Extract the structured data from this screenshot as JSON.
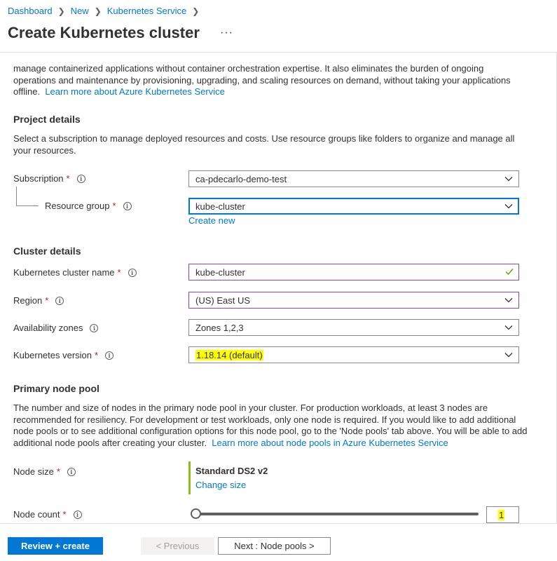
{
  "breadcrumb": [
    "Dashboard",
    "New",
    "Kubernetes Service"
  ],
  "page_title": "Create Kubernetes cluster",
  "more_label": "···",
  "intro": {
    "text": "manage containerized applications without container orchestration expertise. It also eliminates the burden of ongoing operations and maintenance by provisioning, upgrading, and scaling resources on demand, without taking your applications offline.",
    "link": "Learn more about Azure Kubernetes Service"
  },
  "project": {
    "heading": "Project details",
    "description": "Select a subscription to manage deployed resources and costs. Use resource groups like folders to organize and manage all your resources.",
    "subscription_label": "Subscription",
    "subscription_value": "ca-pdecarlo-demo-test",
    "resource_group_label": "Resource group",
    "resource_group_value": "kube-cluster",
    "create_new": "Create new"
  },
  "cluster": {
    "heading": "Cluster details",
    "name_label": "Kubernetes cluster name",
    "name_value": "kube-cluster",
    "region_label": "Region",
    "region_value": "(US) East US",
    "zones_label": "Availability zones",
    "zones_value": "Zones 1,2,3",
    "version_label": "Kubernetes version",
    "version_value": "1.18.14 (default)"
  },
  "node_pool": {
    "heading": "Primary node pool",
    "description": "The number and size of nodes in the primary node pool in your cluster. For production workloads, at least 3 nodes are recommended for resiliency. For development or test workloads, only one node is required. If you would like to add additional node pools or to see additional configuration options for this node pool, go to the 'Node pools' tab above. You will be able to add additional node pools after creating your cluster.",
    "link": "Learn more about node pools in Azure Kubernetes Service",
    "size_label": "Node size",
    "size_value": "Standard DS2 v2",
    "change_size": "Change size",
    "count_label": "Node count",
    "count_value": "1"
  },
  "required_mark": "*",
  "info_glyph": "i",
  "footer": {
    "review_create": "Review + create",
    "previous": "< Previous",
    "next": "Next : Node pools >"
  },
  "colors": {
    "accent": "#0078d4",
    "required": "#a4262c",
    "highlight": "#ffff00",
    "valid_border": "#8c4799",
    "node_size_bar": "#8cbd18"
  }
}
